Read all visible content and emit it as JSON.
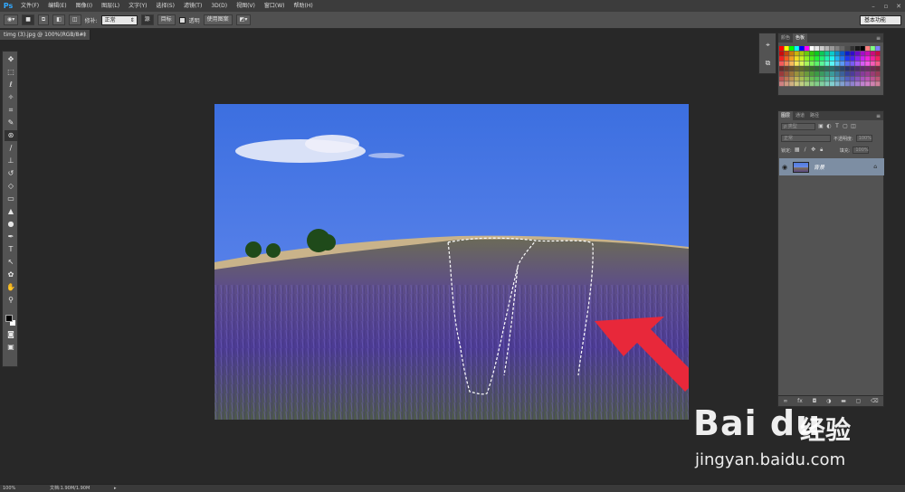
{
  "app": {
    "logo": "Ps"
  },
  "menu": [
    "文件(F)",
    "编辑(E)",
    "图像(I)",
    "图层(L)",
    "文字(Y)",
    "选择(S)",
    "滤镜(T)",
    "3D(D)",
    "视图(V)",
    "窗口(W)",
    "帮助(H)"
  ],
  "options": {
    "feather_label": "修补:",
    "mode_value": "正常",
    "source_label": "源",
    "dest_label": "目标",
    "transparent_label": "透明",
    "use_pattern_label": "使用图案",
    "workspace": "基本功能"
  },
  "document": {
    "tab_title": "timg (3).jpg @ 100%(RGB/8#)"
  },
  "swatches_panel": {
    "tabs": [
      "颜色",
      "色板"
    ]
  },
  "layers_panel": {
    "tabs": [
      "图层",
      "通道",
      "路径"
    ],
    "kind_label": "ρ 类型",
    "blend_mode": "正常",
    "opacity_label": "不透明度:",
    "opacity_value": "100%",
    "lock_label": "锁定:",
    "fill_label": "填充:",
    "fill_value": "100%",
    "layer_name": "背景"
  },
  "status": {
    "zoom": "100%",
    "doc_info": "文档:1.90M/1.90M"
  },
  "watermark": {
    "logo": "Bai du",
    "cn": "经验",
    "url": "jingyan.baidu.com"
  },
  "colors": {
    "accent": "#31a8ff",
    "arrow": "#e8283a",
    "layer_selected": "#7d8ea3"
  }
}
